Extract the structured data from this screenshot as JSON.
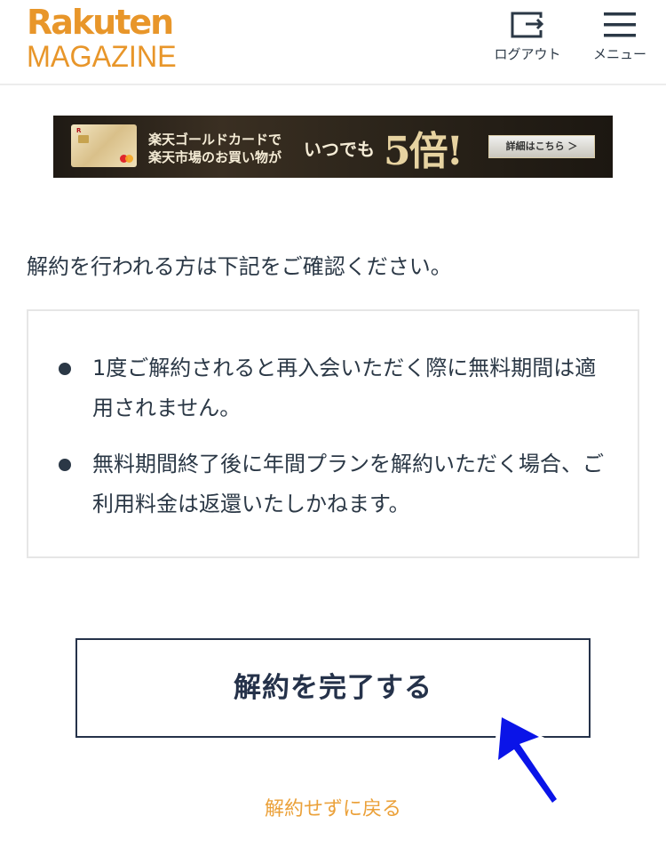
{
  "header": {
    "logo_top": "Rakuten",
    "logo_bottom": "MAGAZINE",
    "logout_label": "ログアウト",
    "menu_label": "メニュー"
  },
  "banner": {
    "line1": "楽天ゴールドカードで",
    "line2": "楽天市場のお買い物が",
    "emphasis": "いつでも",
    "multiplier": "5倍!",
    "cta": "詳細はこちら ＞"
  },
  "intro_text": "解約を行われる方は下記をご確認ください。",
  "notices": [
    "1度ご解約されると再入会いただく際に無料期間は適用されません。",
    "無料期間終了後に年間プランを解約いただく場合、ご利用料金は返還いたしかねます。"
  ],
  "complete_button": "解約を完了する",
  "back_link": "解約せずに戻る",
  "colors": {
    "brand": "#e8962a",
    "text": "#2b3846",
    "button_border": "#25324a",
    "link": "#eba13a",
    "arrow": "#0a14e8"
  },
  "icons": {
    "logout": "logout-icon",
    "menu": "hamburger-menu-icon",
    "annotation": "pointer-arrow-icon"
  }
}
